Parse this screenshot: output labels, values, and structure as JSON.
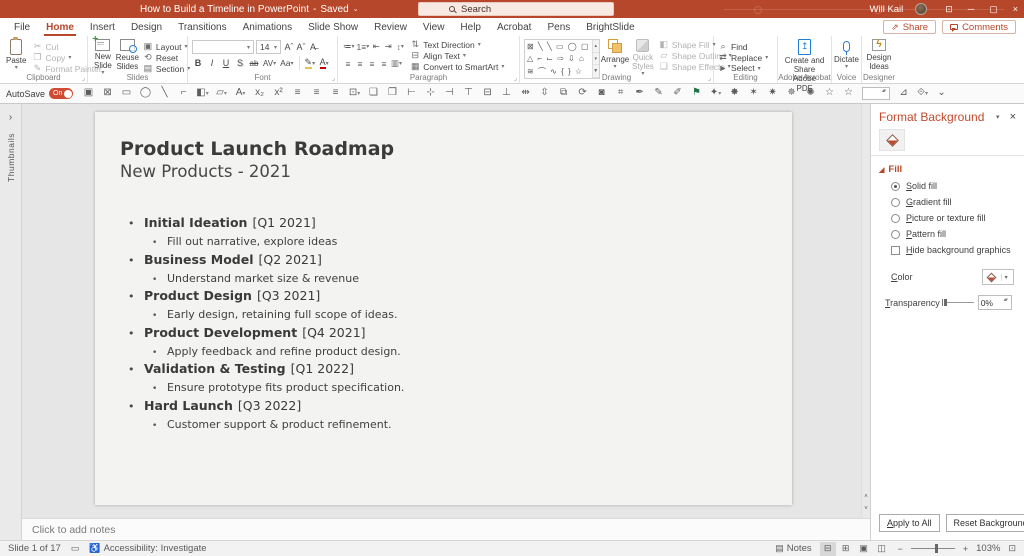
{
  "colors": {
    "accent": "#b7472a",
    "pdf_blue": "#1f7fd4",
    "mic_blue": "#2b7cd3",
    "designer_gold": "#b8860b",
    "autosave_on": "#cf4b32"
  },
  "titlebar": {
    "title": "How to Build a Timeline in PowerPoint",
    "separator": "-",
    "saved": "Saved",
    "saved_caret": "⌄",
    "search": "Search",
    "user": "Will Kail",
    "controls": [
      {
        "name": "ribbon-display-options-icon",
        "glyph": "⊡"
      },
      {
        "name": "minimize-icon",
        "glyph": "─"
      },
      {
        "name": "restore-icon",
        "glyph": "▢"
      },
      {
        "name": "close-icon",
        "glyph": "×"
      }
    ]
  },
  "tabs": [
    {
      "name": "tab-file",
      "label": "File"
    },
    {
      "name": "tab-home",
      "label": "Home",
      "active": true
    },
    {
      "name": "tab-insert",
      "label": "Insert"
    },
    {
      "name": "tab-design",
      "label": "Design"
    },
    {
      "name": "tab-transitions",
      "label": "Transitions"
    },
    {
      "name": "tab-animations",
      "label": "Animations"
    },
    {
      "name": "tab-slide-show",
      "label": "Slide Show"
    },
    {
      "name": "tab-review",
      "label": "Review"
    },
    {
      "name": "tab-view",
      "label": "View"
    },
    {
      "name": "tab-help",
      "label": "Help"
    },
    {
      "name": "tab-acrobat",
      "label": "Acrobat"
    },
    {
      "name": "tab-pens",
      "label": "Pens"
    },
    {
      "name": "tab-brightslide",
      "label": "BrightSlide"
    }
  ],
  "actions": {
    "share": "Share",
    "comments": "Comments"
  },
  "ribbon": {
    "clipboard": {
      "label": "Clipboard",
      "paste": "Paste",
      "paste_caret": "▾",
      "items": [
        {
          "name": "cut-button",
          "glyph": "✂",
          "label": "Cut",
          "disabled": true
        },
        {
          "name": "copy-button",
          "glyph": "❐",
          "label": "Copy",
          "caret": "▾",
          "disabled": true
        },
        {
          "name": "format-painter-button",
          "glyph": "✎",
          "label": "Format Painter",
          "disabled": true
        }
      ]
    },
    "slides": {
      "label": "Slides",
      "new_slide": "New Slide",
      "new_caret": "▾",
      "reuse": "Reuse Slides",
      "items": [
        {
          "name": "layout-button",
          "glyph": "▣",
          "label": "Layout",
          "caret": "▾"
        },
        {
          "name": "reset-button",
          "glyph": "⟲",
          "label": "Reset"
        },
        {
          "name": "section-button",
          "glyph": "▤",
          "label": "Section",
          "caret": "▾"
        }
      ]
    },
    "font": {
      "label": "Font",
      "font_name": "",
      "size": "14",
      "row1_buttons": [
        {
          "name": "increase-font-size-button",
          "glyph": "Aˆ"
        },
        {
          "name": "decrease-font-size-button",
          "glyph": "Aˇ"
        },
        {
          "name": "clear-formatting-button",
          "glyph": "A̶"
        }
      ],
      "bold": "B",
      "italic": "I",
      "underline": "U",
      "shadow": "S",
      "strike": "ab",
      "spacing": "AV",
      "case": "Aa",
      "highlight": "✎",
      "font_color": "A"
    },
    "paragraph": {
      "label": "Paragraph",
      "row1": [
        {
          "name": "bullets-button",
          "glyph": "≔",
          "caret": "▾"
        },
        {
          "name": "numbering-button",
          "glyph": "1≡",
          "caret": "▾"
        },
        {
          "name": "decrease-indent-button",
          "glyph": "⇤"
        },
        {
          "name": "increase-indent-button",
          "glyph": "⇥"
        },
        {
          "name": "line-spacing-button",
          "glyph": "↕",
          "caret": "▾"
        }
      ],
      "row2": [
        {
          "name": "align-left-button",
          "glyph": "≡"
        },
        {
          "name": "align-center-button",
          "glyph": "≡"
        },
        {
          "name": "align-right-button",
          "glyph": "≡"
        },
        {
          "name": "justify-button",
          "glyph": "≡"
        },
        {
          "name": "columns-button",
          "glyph": "▥",
          "caret": "▾"
        }
      ],
      "right": [
        {
          "name": "text-direction-button",
          "glyph": "⇅",
          "label": "Text Direction",
          "caret": "▾"
        },
        {
          "name": "align-text-button",
          "glyph": "⊟",
          "label": "Align Text",
          "caret": "▾"
        },
        {
          "name": "convert-to-smartart-button",
          "glyph": "▦",
          "label": "Convert to SmartArt",
          "caret": "▾"
        }
      ]
    },
    "drawing": {
      "label": "Drawing",
      "gallery_rows": [
        "⊠ ╲ ╲ ▭ ◯ ▢",
        "△ ⌐ ⌙ ⇨ ⇩ ⌂",
        "≋ ⌒ ∿ { } ☆"
      ],
      "gallery_scroll": [
        "▴",
        "▾",
        "▼"
      ],
      "arrange": "Arrange",
      "arrange_caret": "▾",
      "quick_styles": "Quick Styles",
      "quick_caret": "▾",
      "right": [
        {
          "name": "shape-fill-button",
          "glyph": "◧",
          "label": "Shape Fill",
          "caret": "▾",
          "disabled": true
        },
        {
          "name": "shape-outline-button",
          "glyph": "▱",
          "label": "Shape Outline",
          "caret": "▾",
          "disabled": true
        },
        {
          "name": "shape-effects-button",
          "glyph": "❏",
          "label": "Shape Effects",
          "caret": "▾",
          "disabled": true
        }
      ]
    },
    "editing": {
      "label": "Editing",
      "items": [
        {
          "name": "find-button",
          "glyph": "⌕",
          "label": "Find"
        },
        {
          "name": "replace-button",
          "glyph": "⇄",
          "label": "Replace",
          "caret": "▾"
        },
        {
          "name": "select-button",
          "glyph": "►",
          "label": "Select",
          "caret": "▾"
        }
      ]
    },
    "acrobat": {
      "label": "Adobe Acrobat",
      "button": "Create and Share Adobe PDF"
    },
    "voice": {
      "label": "Voice",
      "dictate": "Dictate",
      "caret": "▾"
    },
    "designer": {
      "label": "Designer",
      "button": "Design Ideas",
      "bolt": "ϟ"
    }
  },
  "qat": {
    "autosave": "AutoSave",
    "on": "On",
    "icons": [
      {
        "name": "save-icon",
        "glyph": "▣"
      },
      {
        "name": "text-box-icon",
        "glyph": "⊠"
      },
      {
        "name": "rectangle-icon",
        "glyph": "▭"
      },
      {
        "name": "oval-icon",
        "glyph": "◯"
      },
      {
        "name": "line-icon",
        "glyph": "╲"
      },
      {
        "name": "elbow-connector-icon",
        "glyph": "⌐"
      },
      {
        "name": "shape-fill-icon",
        "glyph": "◧",
        "caret": "▾"
      },
      {
        "name": "shape-outline-icon",
        "glyph": "▱",
        "caret": "▾"
      },
      {
        "name": "font-color-icon",
        "glyph": "A",
        "caret": "▾"
      },
      {
        "name": "subscript-icon",
        "glyph": "x₂"
      },
      {
        "name": "superscript-icon",
        "glyph": "x²"
      },
      {
        "name": "align-left-icon",
        "glyph": "≡"
      },
      {
        "name": "align-center-icon",
        "glyph": "≡"
      },
      {
        "name": "align-right-icon",
        "glyph": "≡"
      },
      {
        "name": "text-direction-icon",
        "glyph": "⊡",
        "caret": "▾"
      },
      {
        "name": "bring-forward-icon",
        "glyph": "❏"
      },
      {
        "name": "send-backward-icon",
        "glyph": "❐"
      },
      {
        "name": "align-objects-left-icon",
        "glyph": "⊢"
      },
      {
        "name": "align-objects-center-icon",
        "glyph": "⊹"
      },
      {
        "name": "align-objects-right-icon",
        "glyph": "⊣"
      },
      {
        "name": "align-objects-top-icon",
        "glyph": "⊤"
      },
      {
        "name": "align-objects-middle-icon",
        "glyph": "⊟"
      },
      {
        "name": "align-objects-bottom-icon",
        "glyph": "⊥"
      },
      {
        "name": "distribute-horizontally-icon",
        "glyph": "⇹"
      },
      {
        "name": "distribute-vertically-icon",
        "glyph": "⇳"
      },
      {
        "name": "group-objects-icon",
        "glyph": "⧉"
      },
      {
        "name": "rotate-objects-icon",
        "glyph": "⟳"
      },
      {
        "name": "merge-shapes-icon",
        "glyph": "◙"
      },
      {
        "name": "crop-icon",
        "glyph": "⌗"
      },
      {
        "name": "eyedropper-icon",
        "glyph": "✒"
      },
      {
        "name": "draw-pen-icon",
        "glyph": "✎"
      },
      {
        "name": "draw-highlighter-icon",
        "glyph": "✐"
      },
      {
        "name": "flag-icon",
        "glyph": "⚑",
        "tint": "green"
      },
      {
        "name": "new-star-icon",
        "glyph": "✦",
        "caret": "▾"
      },
      {
        "name": "star-burst-1-icon",
        "glyph": "✸"
      },
      {
        "name": "star-burst-2-icon",
        "glyph": "✶"
      },
      {
        "name": "star-burst-3-icon",
        "glyph": "✷"
      },
      {
        "name": "star-burst-4-icon",
        "glyph": "✵"
      },
      {
        "name": "star-burst-5-icon",
        "glyph": "✺"
      },
      {
        "name": "star-outline-1-icon",
        "glyph": "☆"
      },
      {
        "name": "star-outline-2-icon",
        "glyph": "☆"
      }
    ],
    "spin_value": "",
    "tail_icons": [
      {
        "name": "freeform-shape-icon",
        "glyph": "⊿"
      },
      {
        "name": "change-shape-icon",
        "glyph": "⟐",
        "caret": "▾"
      },
      {
        "name": "qat-overflow-icon",
        "glyph": "⌄"
      }
    ]
  },
  "thumbs": {
    "label": "Thumbnails",
    "chevron": "›"
  },
  "slide": {
    "title": "Product Launch Roadmap",
    "subtitle": "New Products - 2021",
    "bullets": [
      {
        "main": "Initial Ideation",
        "tag": "[Q1 2021]",
        "sub": "Fill out narrative, explore ideas"
      },
      {
        "main": "Business Model",
        "tag": "[Q2 2021]",
        "sub": "Understand market size & revenue"
      },
      {
        "main": "Product Design",
        "tag": "[Q3 2021]",
        "sub": "Early design, retaining full scope of ideas."
      },
      {
        "main": "Product Development",
        "tag": "[Q4 2021]",
        "sub": "Apply feedback and refine product design."
      },
      {
        "main": "Validation & Testing",
        "tag": "[Q1 2022]",
        "sub": "Ensure prototype fits product specification."
      },
      {
        "main": "Hard Launch",
        "tag": "[Q3 2022]",
        "sub": "Customer support & product refinement."
      }
    ]
  },
  "notes": {
    "placeholder": "Click to add notes"
  },
  "pane": {
    "title": "Format Background",
    "caret": "▾",
    "close": "×",
    "section_marker": "◢",
    "section": "Fill",
    "options": [
      {
        "name": "solid-fill-radio",
        "label": "Solid fill",
        "selected": true
      },
      {
        "name": "gradient-fill-radio",
        "label": "Gradient fill"
      },
      {
        "name": "picture-or-texture-fill-radio",
        "label": "Picture or texture fill"
      },
      {
        "name": "pattern-fill-radio",
        "label": "Pattern fill"
      }
    ],
    "hide_bg": "Hide background graphics",
    "color_label": "Color",
    "color_caret": "▾",
    "transparency_label": "Transparency",
    "transparency_value": "0%",
    "apply_all": "Apply to All",
    "reset_bg": "Reset Background"
  },
  "statusbar": {
    "slide_info": "Slide 1 of 17",
    "display_icon": "▭",
    "accessibility_icon": "♿",
    "accessibility": "Accessibility: Investigate",
    "notes_icon": "▤",
    "notes": "Notes",
    "views": [
      {
        "name": "normal-view-button",
        "glyph": "⊟",
        "active": true
      },
      {
        "name": "slide-sorter-view-button",
        "glyph": "⊞"
      },
      {
        "name": "reading-view-button",
        "glyph": "▣"
      },
      {
        "name": "slideshow-button",
        "glyph": "◫"
      }
    ],
    "zoom_out": "−",
    "zoom_in": "+",
    "zoom_level": "103%",
    "fit_icon": "⊡"
  }
}
